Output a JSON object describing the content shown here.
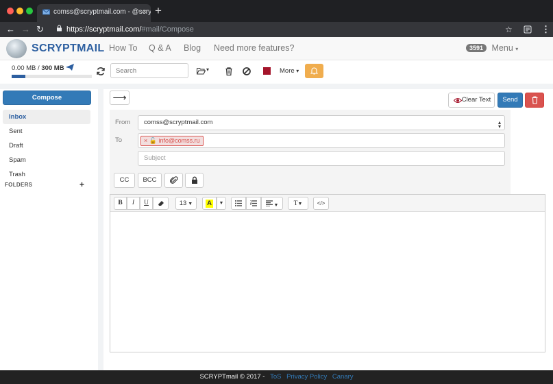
{
  "browser": {
    "tab_title": "comss@scryptmail.com - @scryptmail",
    "tab_close": "×",
    "new_tab": "+",
    "url_host": "https://scryptmail.com/",
    "url_path": "#mail/Compose"
  },
  "header": {
    "logo": "SCRYPTMAIL",
    "nav": [
      "How To",
      "Q & A",
      "Blog",
      "Need more features?"
    ],
    "badge": "3591",
    "menu": "Menu"
  },
  "toolbar": {
    "quota_used": "0.00 MB",
    "quota_sep": " / ",
    "quota_total": "300 MB",
    "quota_fraction": 0.0,
    "search_placeholder": "Search",
    "more": "More"
  },
  "sidebar": {
    "compose": "Compose",
    "items": [
      {
        "label": "Inbox",
        "active": true
      },
      {
        "label": "Sent"
      },
      {
        "label": "Draft"
      },
      {
        "label": "Spam"
      },
      {
        "label": "Trash"
      }
    ],
    "folders_heading": "FOLDERS",
    "folders_add": "+"
  },
  "compose": {
    "arrow": "⟶",
    "clear_text": "Clear Text",
    "send": "Send",
    "from_label": "From",
    "from_value": "comss@scryptmail.com",
    "to_label": "To",
    "to_chip": "info@comss.ru",
    "subject_placeholder": "Subject",
    "cc": "CC",
    "bcc": "BCC"
  },
  "editor": {
    "bold": "B",
    "italic": "I",
    "underline": "U",
    "font_size": "13",
    "text_style": "T"
  },
  "footer": {
    "copyright": "SCRYPTmail © 2017 -",
    "links": [
      "ToS",
      "Privacy Policy",
      "Canary"
    ]
  },
  "colors": {
    "brand": "#2d5fa0",
    "primary": "#337ab7",
    "danger": "#d9534f",
    "warning": "#f0ad4e",
    "stop_square": "#a4152b"
  }
}
